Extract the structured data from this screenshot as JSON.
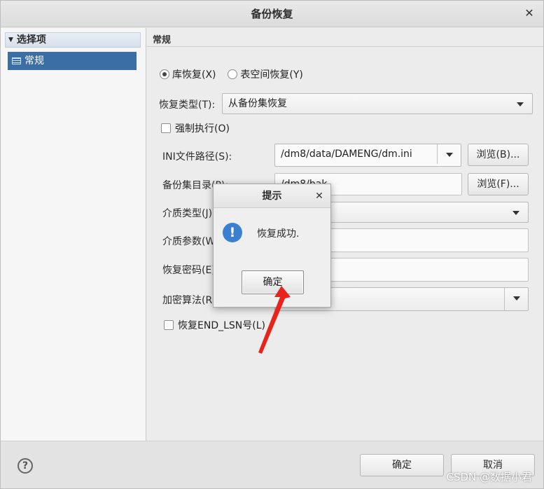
{
  "window": {
    "title": "备份恢复"
  },
  "sidebar": {
    "header": "选择项",
    "items": [
      {
        "label": "常规"
      }
    ]
  },
  "general": {
    "section_title": "常规",
    "radio_db": "库恢复(X)",
    "radio_tablespace": "表空间恢复(Y)",
    "restore_type_label": "恢复类型(T):",
    "restore_type_value": "从备份集恢复",
    "force_label": "强制执行(O)",
    "ini_label": "INI文件路径(S):",
    "ini_value": "/dm8/data/DAMENG/dm.ini",
    "browse_b": "浏览(B)...",
    "backup_dir_label": "备份集目录(P):",
    "backup_dir_value": "/dm8/bak",
    "browse_f": "浏览(F)...",
    "media_type_label": "介质类型(J):",
    "media_param_label": "介质参数(W):",
    "restore_pwd_label": "恢复密码(E):",
    "encrypt_algo_label": "加密算法(R):",
    "end_lsn_label": "恢复END_LSN号(L)"
  },
  "footer": {
    "ok": "确定",
    "cancel": "取消",
    "watermark": "CSDN @数据小君"
  },
  "dialog": {
    "title": "提示",
    "message": "恢复成功.",
    "ok": "确定"
  },
  "colors": {
    "selection": "#3c6ea6",
    "info_icon": "#3b7fd0",
    "annotation_arrow": "#e8231b"
  }
}
